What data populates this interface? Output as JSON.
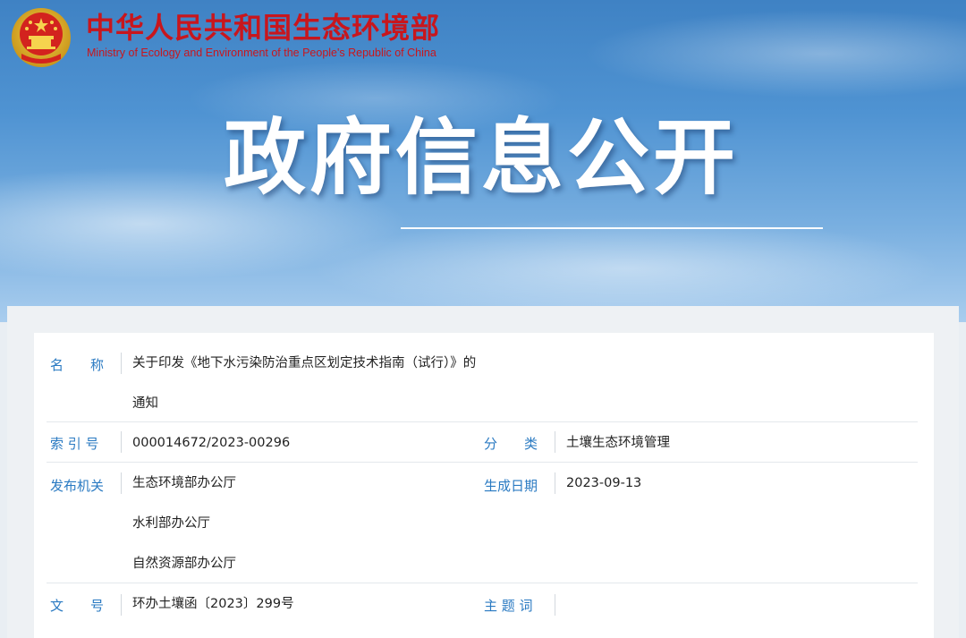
{
  "header": {
    "ministry_cn": "中华人民共和国生态环境部",
    "ministry_en": "Ministry of Ecology and Environment of the People's Republic of China",
    "emblem_icon": "national-emblem-icon",
    "banner_title": "政府信息公开"
  },
  "colors": {
    "brand_red": "#c8161d",
    "label_blue": "#2a7ac2",
    "sky_blue": "#4f93d2"
  },
  "info": {
    "name_label": "名　　称",
    "name_line1": "关于印发《地下水污染防治重点区划定技术指南（试行）》的",
    "name_line2": "通知",
    "index_label": "索 引 号",
    "index_value": "000014672/2023-00296",
    "category_label": "分　　类",
    "category_value": "土壤生态环境管理",
    "issuer_label": "发布机关",
    "issuers": [
      "生态环境部办公厅",
      "水利部办公厅",
      "自然资源部办公厅"
    ],
    "date_label": "生成日期",
    "date_value": "2023-09-13",
    "docno_label": "文　　号",
    "docno_value": "环办土壤函〔2023〕299号",
    "subject_label": "主 题 词",
    "subject_value": ""
  }
}
